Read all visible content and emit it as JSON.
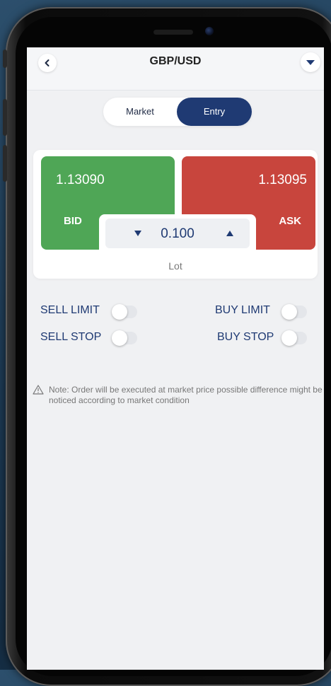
{
  "header": {
    "title": "GBP/USD",
    "back_icon": "chevron-left-icon",
    "menu_icon": "caret-down-icon"
  },
  "tabs": {
    "items": [
      {
        "label": "Market",
        "active": false
      },
      {
        "label": "Entry",
        "active": true
      }
    ]
  },
  "quote": {
    "bid": {
      "price": "1.13090",
      "label": "BID",
      "color": "#4fa656"
    },
    "ask": {
      "price": "1.13095",
      "label": "ASK",
      "color": "#c8453d"
    }
  },
  "lot": {
    "value": "0.100",
    "label": "Lot",
    "decrease_icon": "triangle-down-icon",
    "increase_icon": "triangle-up-icon"
  },
  "orders": {
    "sell_limit": {
      "label": "SELL LIMIT",
      "enabled": false
    },
    "buy_limit": {
      "label": "BUY LIMIT",
      "enabled": false
    },
    "sell_stop": {
      "label": "SELL STOP",
      "enabled": false
    },
    "buy_stop": {
      "label": "BUY STOP",
      "enabled": false
    }
  },
  "note": {
    "icon": "warning-icon",
    "text": "Note: Order will be executed at market price possible difference might be noticed according to market condition"
  },
  "colors": {
    "accent": "#1f3a73",
    "background": "#f0f1f3"
  }
}
